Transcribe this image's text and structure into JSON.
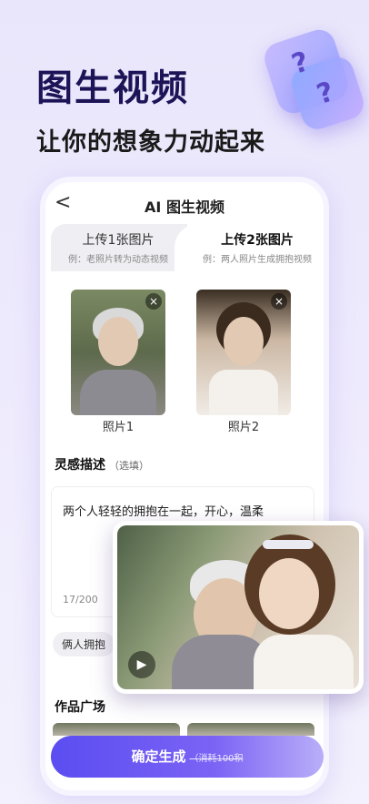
{
  "hero": {
    "title": "图生视频",
    "subtitle": "让你的想象力动起来"
  },
  "nav": {
    "back_icon": "<",
    "title": "AI 图生视频"
  },
  "tabs": [
    {
      "label": "上传1张图片",
      "hint": "例：老照片转为动态视频"
    },
    {
      "label": "上传2张图片",
      "hint": "例：两人照片生成拥抱视频"
    }
  ],
  "photos": [
    {
      "label": "照片1"
    },
    {
      "label": "照片2"
    }
  ],
  "close_glyph": "×",
  "inspiration": {
    "title": "灵感描述",
    "optional": "（选填）",
    "text": "两个人轻轻的拥抱在一起，开心，温柔",
    "count": "17/200"
  },
  "chip": "俩人拥抱",
  "works": {
    "title": "作品广场"
  },
  "cta": {
    "label": "确定生成",
    "cost": "（消耗100积"
  },
  "play_glyph": "▶",
  "colors": {
    "brand": "#5b4df1",
    "hero_title": "#1c1457"
  }
}
